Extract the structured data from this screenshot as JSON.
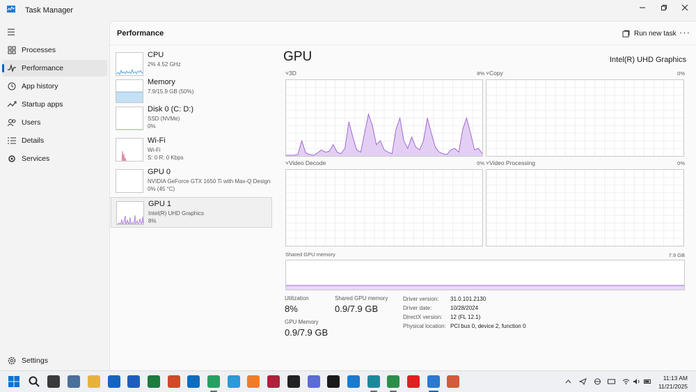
{
  "window": {
    "title": "Task Manager",
    "minimize_icon": "minimize-icon",
    "maximize_icon": "restore-icon",
    "close_icon": "close-icon"
  },
  "sidebar": {
    "items": [
      {
        "label": "Processes",
        "icon": "processes-icon"
      },
      {
        "label": "Performance",
        "icon": "performance-icon",
        "active": true
      },
      {
        "label": "App history",
        "icon": "history-icon"
      },
      {
        "label": "Startup apps",
        "icon": "startup-icon"
      },
      {
        "label": "Users",
        "icon": "users-icon"
      },
      {
        "label": "Details",
        "icon": "details-icon"
      },
      {
        "label": "Services",
        "icon": "services-icon"
      }
    ],
    "settings_label": "Settings"
  },
  "header": {
    "title": "Performance",
    "run_task_label": "Run new task",
    "more_label": "···"
  },
  "devices": [
    {
      "name": "CPU",
      "line1": "2% 4.52 GHz",
      "line2": ""
    },
    {
      "name": "Memory",
      "line1": "7.9/15.9 GB (50%)",
      "line2": ""
    },
    {
      "name": "Disk 0 (C: D:)",
      "line1": "SSD (NVMe)",
      "line2": "0%"
    },
    {
      "name": "Wi-Fi",
      "line1": "Wi-Fi",
      "line2": "S: 0  R: 0 Kbps"
    },
    {
      "name": "GPU 0",
      "line1": "NVIDIA GeForce GTX 1650 Ti with Max-Q Design",
      "line2": "0% (45 °C)"
    },
    {
      "name": "GPU 1",
      "line1": "Intel(R) UHD Graphics",
      "line2": "8%",
      "active": true
    }
  ],
  "gpu": {
    "heading": "GPU",
    "model": "Intel(R) UHD Graphics",
    "engines": [
      {
        "label": "3D",
        "value": "8%"
      },
      {
        "label": "Copy",
        "value": "0%"
      },
      {
        "label": "Video Decode",
        "value": "0%"
      },
      {
        "label": "Video Processing",
        "value": "0%"
      }
    ],
    "shared_memory_label": "Shared GPU memory",
    "shared_memory_max": "7.9 GB",
    "stats": {
      "utilization_label": "Utilization",
      "utilization_value": "8%",
      "shared_label": "Shared GPU memory",
      "shared_value": "0.9/7.9 GB",
      "gpu_memory_label": "GPU Memory",
      "gpu_memory_value": "0.9/7.9 GB"
    },
    "details": [
      {
        "key": "Driver version:",
        "value": "31.0.101.2130"
      },
      {
        "key": "Driver date:",
        "value": "10/28/2024"
      },
      {
        "key": "DirectX version:",
        "value": "12 (FL 12.1)"
      },
      {
        "key": "Physical location:",
        "value": "PCI bus 0, device 2, function 0"
      }
    ],
    "chart_3d_values": [
      1,
      1,
      1,
      2,
      20,
      4,
      2,
      1,
      4,
      8,
      5,
      6,
      15,
      5,
      3,
      10,
      45,
      25,
      8,
      5,
      30,
      55,
      40,
      15,
      20,
      8,
      5,
      3,
      35,
      50,
      20,
      10,
      25,
      12,
      8,
      20,
      50,
      30,
      12,
      5,
      3,
      2,
      8,
      10,
      5,
      35,
      50,
      30,
      8,
      10,
      3
    ]
  },
  "taskbar": {
    "time": "11:13 AM",
    "date": "11/21/2025",
    "apps": [
      {
        "name": "start-icon",
        "color": "#0a72d6"
      },
      {
        "name": "search-icon",
        "color": "#222222"
      },
      {
        "name": "file-explorer-icon",
        "color": "#3a3a3a"
      },
      {
        "name": "settings-app-icon",
        "color": "#4a6f9b"
      },
      {
        "name": "folder-icon",
        "color": "#e6b33a"
      },
      {
        "name": "store-icon",
        "color": "#1565c0"
      },
      {
        "name": "word-icon",
        "color": "#1f5cbf"
      },
      {
        "name": "excel-icon",
        "color": "#1e7a3e"
      },
      {
        "name": "powerpoint-icon",
        "color": "#d2492a"
      },
      {
        "name": "outlook-icon",
        "color": "#0f6cbd"
      },
      {
        "name": "whatsapp-icon",
        "color": "#25a162"
      },
      {
        "name": "telegram-icon",
        "color": "#2a9ad9"
      },
      {
        "name": "pen-icon",
        "color": "#f07c2a"
      },
      {
        "name": "figma-icon",
        "color": "#b0203a"
      },
      {
        "name": "notion-icon",
        "color": "#222222"
      },
      {
        "name": "canva-icon",
        "color": "#5b6bd8"
      },
      {
        "name": "capcut-icon",
        "color": "#1a1a1a"
      },
      {
        "name": "vscode-icon",
        "color": "#1b7acc"
      },
      {
        "name": "edge-icon",
        "color": "#1a8a9a"
      },
      {
        "name": "chrome-icon",
        "color": "#2a8f4a"
      },
      {
        "name": "youtube-icon",
        "color": "#e02020"
      },
      {
        "name": "taskmanager-icon",
        "color": "#2a7ad0"
      },
      {
        "name": "snipping-icon",
        "color": "#d35a3a"
      }
    ]
  }
}
